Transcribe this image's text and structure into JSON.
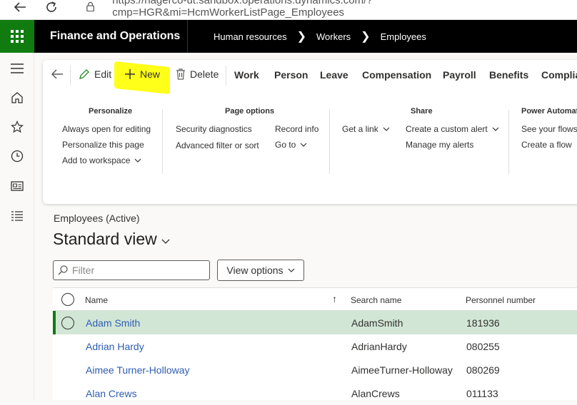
{
  "browser": {
    "url": "https://hagerco-ut.sandbox.operations.dynamics.com/?cmp=HGR&mi=HcmWorkerListPage_Employees"
  },
  "appbar": {
    "title": "Finance and Operations",
    "breadcrumb": [
      "Human resources",
      "Workers",
      "Employees"
    ]
  },
  "toolbar": {
    "edit_label": "Edit",
    "new_label": "New",
    "delete_label": "Delete",
    "tabs": [
      "Work",
      "Person",
      "Leave",
      "Compensation",
      "Payroll",
      "Benefits",
      "Complia"
    ]
  },
  "options": {
    "personalize": {
      "title": "Personalize",
      "items": [
        "Always open for editing",
        "Personalize this page",
        "Add to workspace"
      ]
    },
    "page_options": {
      "title": "Page options",
      "items": [
        "Security diagnostics",
        "Advanced filter or sort",
        "Record info",
        "Go to"
      ]
    },
    "share": {
      "title": "Share",
      "items": [
        "Get a link",
        "Create a custom alert",
        "Manage my alerts"
      ]
    },
    "power_automate": {
      "title": "Power Automate",
      "items": [
        "See your flows",
        "Create a flow"
      ]
    }
  },
  "main": {
    "subtitle": "Employees (Active)",
    "view_title": "Standard view",
    "filter_placeholder": "Filter",
    "view_options_label": "View options"
  },
  "grid": {
    "columns": [
      "Name",
      "Search name",
      "Personnel number"
    ],
    "sort_indicator": "↑",
    "rows": [
      {
        "name": "Adam Smith",
        "search_name": "AdamSmith",
        "personnel_number": "181936",
        "selected": true
      },
      {
        "name": "Adrian Hardy",
        "search_name": "AdrianHardy",
        "personnel_number": "080255",
        "selected": false
      },
      {
        "name": "Aimee Turner-Holloway",
        "search_name": "AimeeTurner-Holloway",
        "personnel_number": "080269",
        "selected": false
      },
      {
        "name": "Alan Crews",
        "search_name": "AlanCrews",
        "personnel_number": "011133",
        "selected": false
      }
    ]
  },
  "colors": {
    "brand_green": "#107c10",
    "highlight": "#ffff00",
    "selected_row": "#d2e6d6",
    "link": "#2e5db0"
  }
}
